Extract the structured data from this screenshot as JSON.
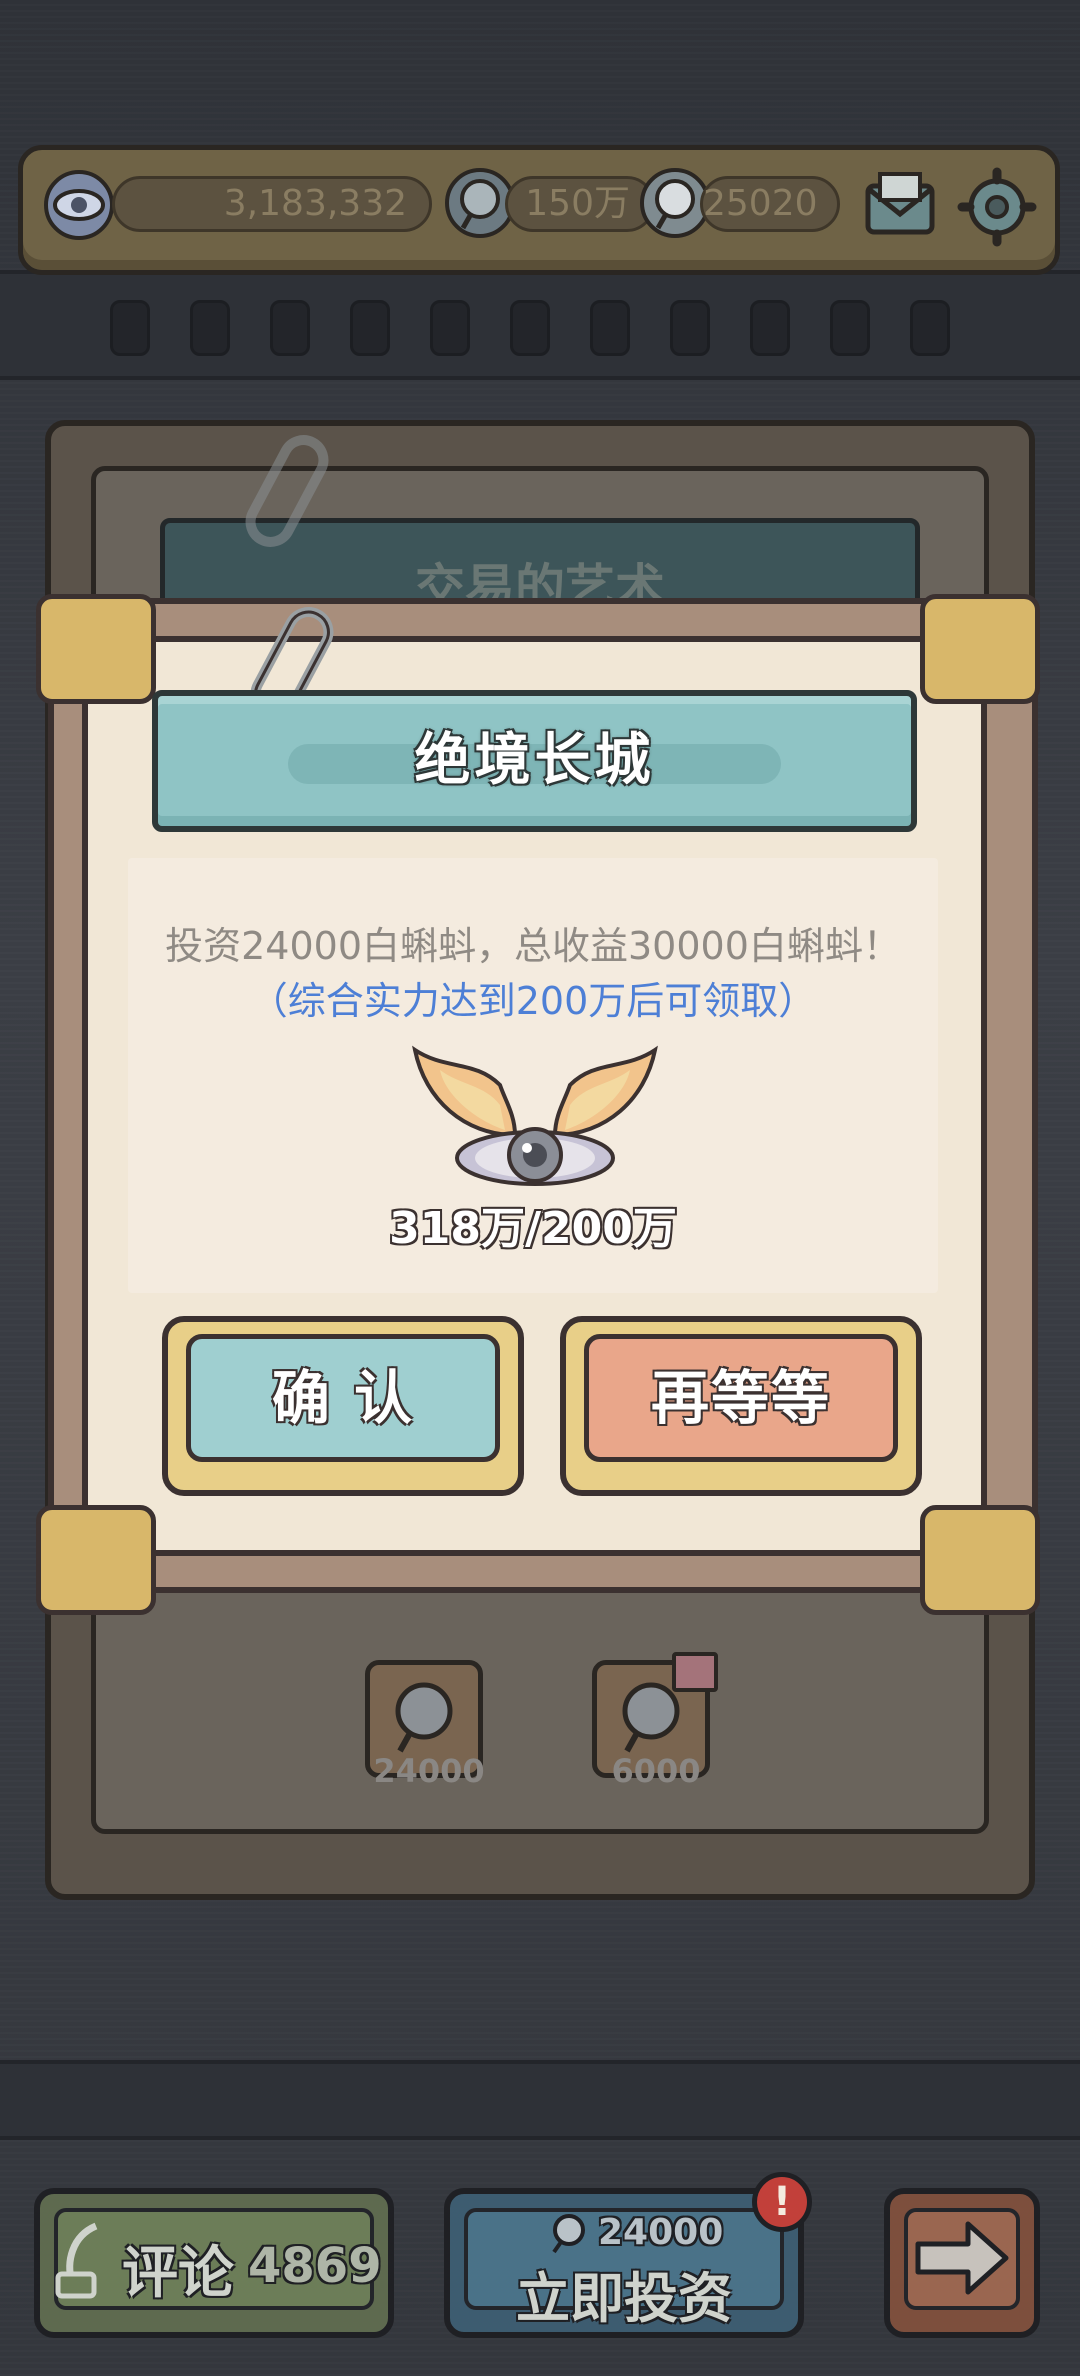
{
  "topbar": {
    "eye_count": "3,183,332",
    "tadpole_count": "150万",
    "white_tadpole_count": "25020"
  },
  "background_card": {
    "title": "交易的艺术",
    "rewards": [
      "24000",
      "6000"
    ]
  },
  "dialog": {
    "title": "绝境长城",
    "description": "投资24000白蝌蚪，总收益30000白蝌蚪！",
    "hint": "（综合实力达到200万后可领取）",
    "progress": "318万/200万",
    "confirm_label": "确  认",
    "wait_label": "再等等"
  },
  "bottom": {
    "comment_label": "评论",
    "comment_count": "4869",
    "invest_cost": "24000",
    "invest_label": "立即投资",
    "badge": "!"
  },
  "colors": {
    "ribbon": "#8fc4c5",
    "confirm": "#9fcfd0",
    "wait": "#e9a68a",
    "hint_blue": "#4d7fd6",
    "gold": "#e8cf88"
  }
}
